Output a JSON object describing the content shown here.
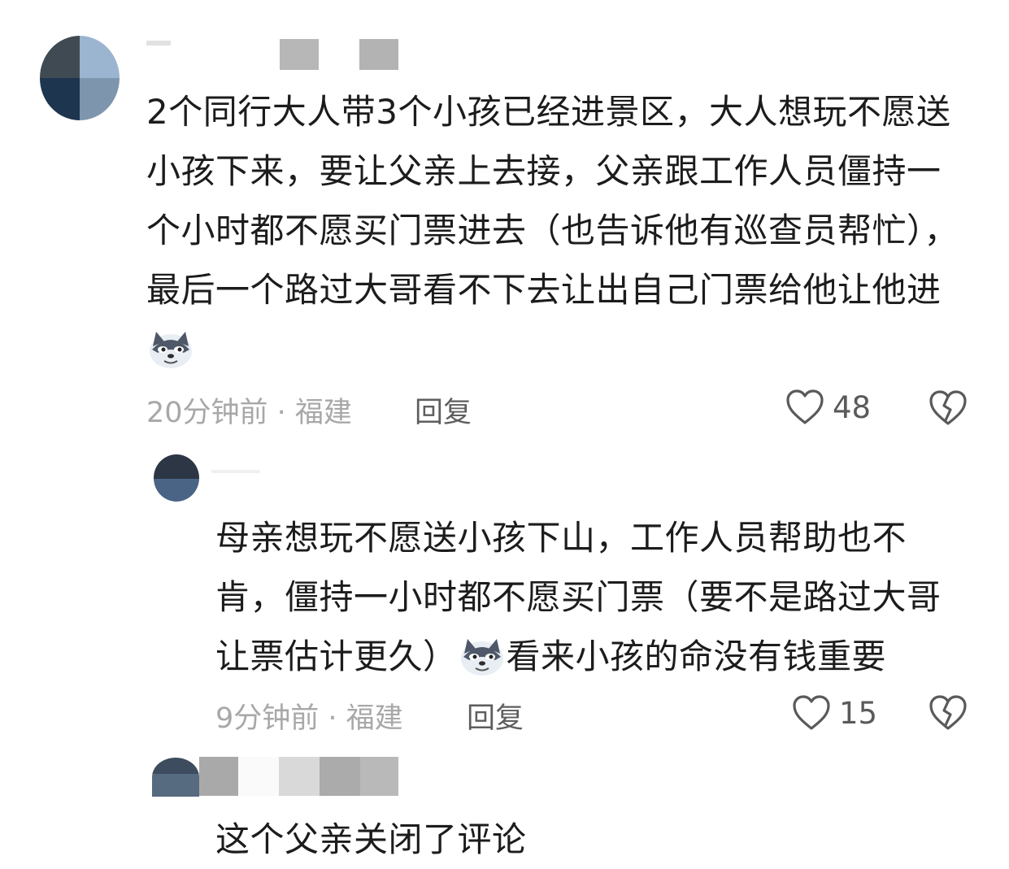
{
  "comments": [
    {
      "text_parts": [
        "2个同行大人带3个小孩已经进景区，大人想玩不愿送小孩下来，要让父亲上去接，父亲跟工作人员僵持一个小时都不愿买门票进去（也告诉他有巡查员帮忙），最后一个路过大哥看不下去让出自己门票给他让他进"
      ],
      "emoji_icon": "doge-wolf-emoji",
      "time_location": "20分钟前 · 福建",
      "reply_label": "回复",
      "like_count": "48"
    },
    {
      "text_before_emoji": "母亲想玩不愿送小孩下山，工作人员帮助也不肯，僵持一小时都不愿买门票（要不是路过大哥让票估计更久）",
      "text_after_emoji": "看来小孩的命没有钱重要",
      "emoji_icon": "doge-wolf-emoji",
      "time_location": "9分钟前 · 福建",
      "reply_label": "回复",
      "like_count": "15"
    },
    {
      "text": "这个父亲关闭了评论"
    }
  ],
  "icons": {
    "like": "heart-outline-icon",
    "dislike": "broken-heart-icon"
  },
  "colors": {
    "meta_gray": "#a8a8a8",
    "reply_gray": "#5e5e5e",
    "text": "#1c1c1c"
  }
}
